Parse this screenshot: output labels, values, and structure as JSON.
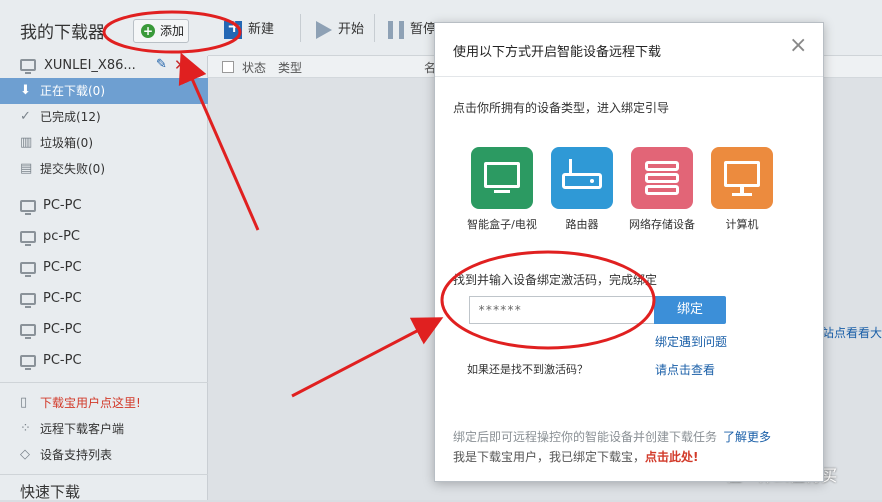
{
  "sidebar": {
    "title": "我的下载器",
    "add_label": "添加",
    "device_name": "XUNLEI_X86...",
    "categories": [
      {
        "label": "正在下载(0)",
        "icon": "download-arrow-icon"
      },
      {
        "label": "已完成(12)",
        "icon": "check-icon"
      },
      {
        "label": "垃圾箱(0)",
        "icon": "trash-icon"
      },
      {
        "label": "提交失败(0)",
        "icon": "failed-icon"
      }
    ],
    "pcs": [
      "PC-PC",
      "pc-PC",
      "PC-PC",
      "PC-PC",
      "PC-PC",
      "PC-PC"
    ],
    "links": [
      {
        "label": "下载宝用户点这里!",
        "icon": "document-icon"
      },
      {
        "label": "远程下载客户端",
        "icon": "grid-icon"
      },
      {
        "label": "设备支持列表",
        "icon": "diamond-icon"
      }
    ],
    "bottom": "快速下载"
  },
  "toolbar": {
    "new_label": "新建",
    "start_label": "开始",
    "pause_label": "暂停"
  },
  "columns": {
    "status": "状态",
    "type": "类型",
    "name": "名"
  },
  "main": {
    "right_hint": "站点看看大",
    "watermark": "值 · 什么值得买"
  },
  "dialog": {
    "title": "使用以下方式开启智能设备远程下载",
    "close_glyph": "×",
    "subtitle": "点击你所拥有的设备类型，进入绑定引导",
    "devices": [
      {
        "label": "智能盒子/电视",
        "color": "#2c9a62"
      },
      {
        "label": "路由器",
        "color": "#2f99d6"
      },
      {
        "label": "网络存储设备",
        "color": "#e26577"
      },
      {
        "label": "计算机",
        "color": "#ec8b3e"
      }
    ],
    "find_text": "找到并输入设备绑定激活码，完成绑定",
    "code_value": "******",
    "bind_label": "绑定",
    "bind_issue": "绑定遇到问题",
    "no_code": "如果还是找不到激活码？",
    "view_link": "请点击查看",
    "footer_text": "绑定后即可远程操控你的智能设备并创建下载任务",
    "learn_more": "了解更多",
    "footer2_text": "我是下载宝用户，我已绑定下载宝，",
    "click_here": "点击此处!"
  },
  "colors": {
    "annotation_red": "#e02020",
    "accent_blue": "#3c8fd8"
  }
}
